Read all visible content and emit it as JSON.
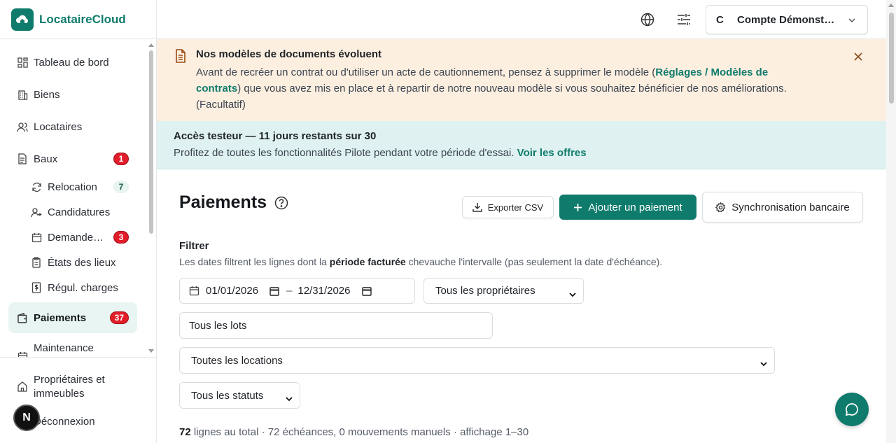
{
  "brand": {
    "name": "LocataireCloud"
  },
  "sidebar": {
    "items": [
      {
        "label": "Tableau de bord",
        "icon": "dashboard-icon"
      },
      {
        "label": "Biens",
        "icon": "building-icon"
      },
      {
        "label": "Locataires",
        "icon": "users-icon"
      },
      {
        "label": "Baux",
        "icon": "file-icon",
        "badge": "1"
      },
      {
        "label": "Relocation",
        "icon": "refresh-icon",
        "badge": "7"
      },
      {
        "label": "Candidatures",
        "icon": "user-plus-icon"
      },
      {
        "label": "Demande…",
        "icon": "calendar-icon",
        "badge": "3"
      },
      {
        "label": "États des lieux",
        "icon": "clipboard-icon"
      },
      {
        "label": "Régul. charges",
        "icon": "dollar-doc-icon"
      },
      {
        "label": "Paiements",
        "icon": "wallet-icon",
        "badge": "37"
      },
      {
        "label": "Maintenance",
        "icon": "tools-icon"
      }
    ],
    "bottom": [
      {
        "label": "Propriétaires et immeubles",
        "icon": "home-icon"
      },
      {
        "label": "Déconnexion",
        "icon": "logout-icon"
      }
    ],
    "avatar_initial": "N"
  },
  "topbar": {
    "account_initial": "C",
    "account_name": "Compte Démonstration"
  },
  "banner_warning": {
    "title": "Nos modèles de documents évoluent",
    "text_before": "Avant de recréer un contrat ou d'utiliser un acte de cautionnement, pensez à supprimer le modèle (",
    "link": "Réglages / Modèles de contrats",
    "text_after": ") que vous avez mis en place et à repartir de notre nouveau modèle si vous souhaitez bénéficier de nos améliorations. (Facultatif)"
  },
  "banner_info": {
    "title": "Accès testeur — 11 jours restants sur 30",
    "text": "Profitez de toutes les fonctionnalités Pilote pendant votre période d'essai.",
    "link": "Voir les offres"
  },
  "page": {
    "title": "Paiements",
    "export_label": "Exporter CSV",
    "add_label": "Ajouter un paiement",
    "sync_label": "Synchronisation bancaire"
  },
  "filter": {
    "title": "Filtrer",
    "desc_before": "Les dates filtrent les lignes dont la ",
    "desc_bold": "période facturée",
    "desc_after": " chevauche l'intervalle (pas seulement la date d'échéance).",
    "date_from": "01/01/2026",
    "date_sep": "–",
    "date_to": "12/31/2026",
    "owner_select": "Tous les propriétaires",
    "lots_input": "Tous les lots",
    "rentals_select": "Toutes les locations",
    "status_select": "Tous les statuts"
  },
  "summary": {
    "count": "72",
    "text": "lignes au total · 72 échéances, 0 mouvements manuels · affichage 1–30"
  },
  "colors": {
    "brand": "#0f7b6c",
    "badge": "#e11d2a",
    "warning_bg": "#fcefe0",
    "info_bg": "#dff2f1"
  }
}
